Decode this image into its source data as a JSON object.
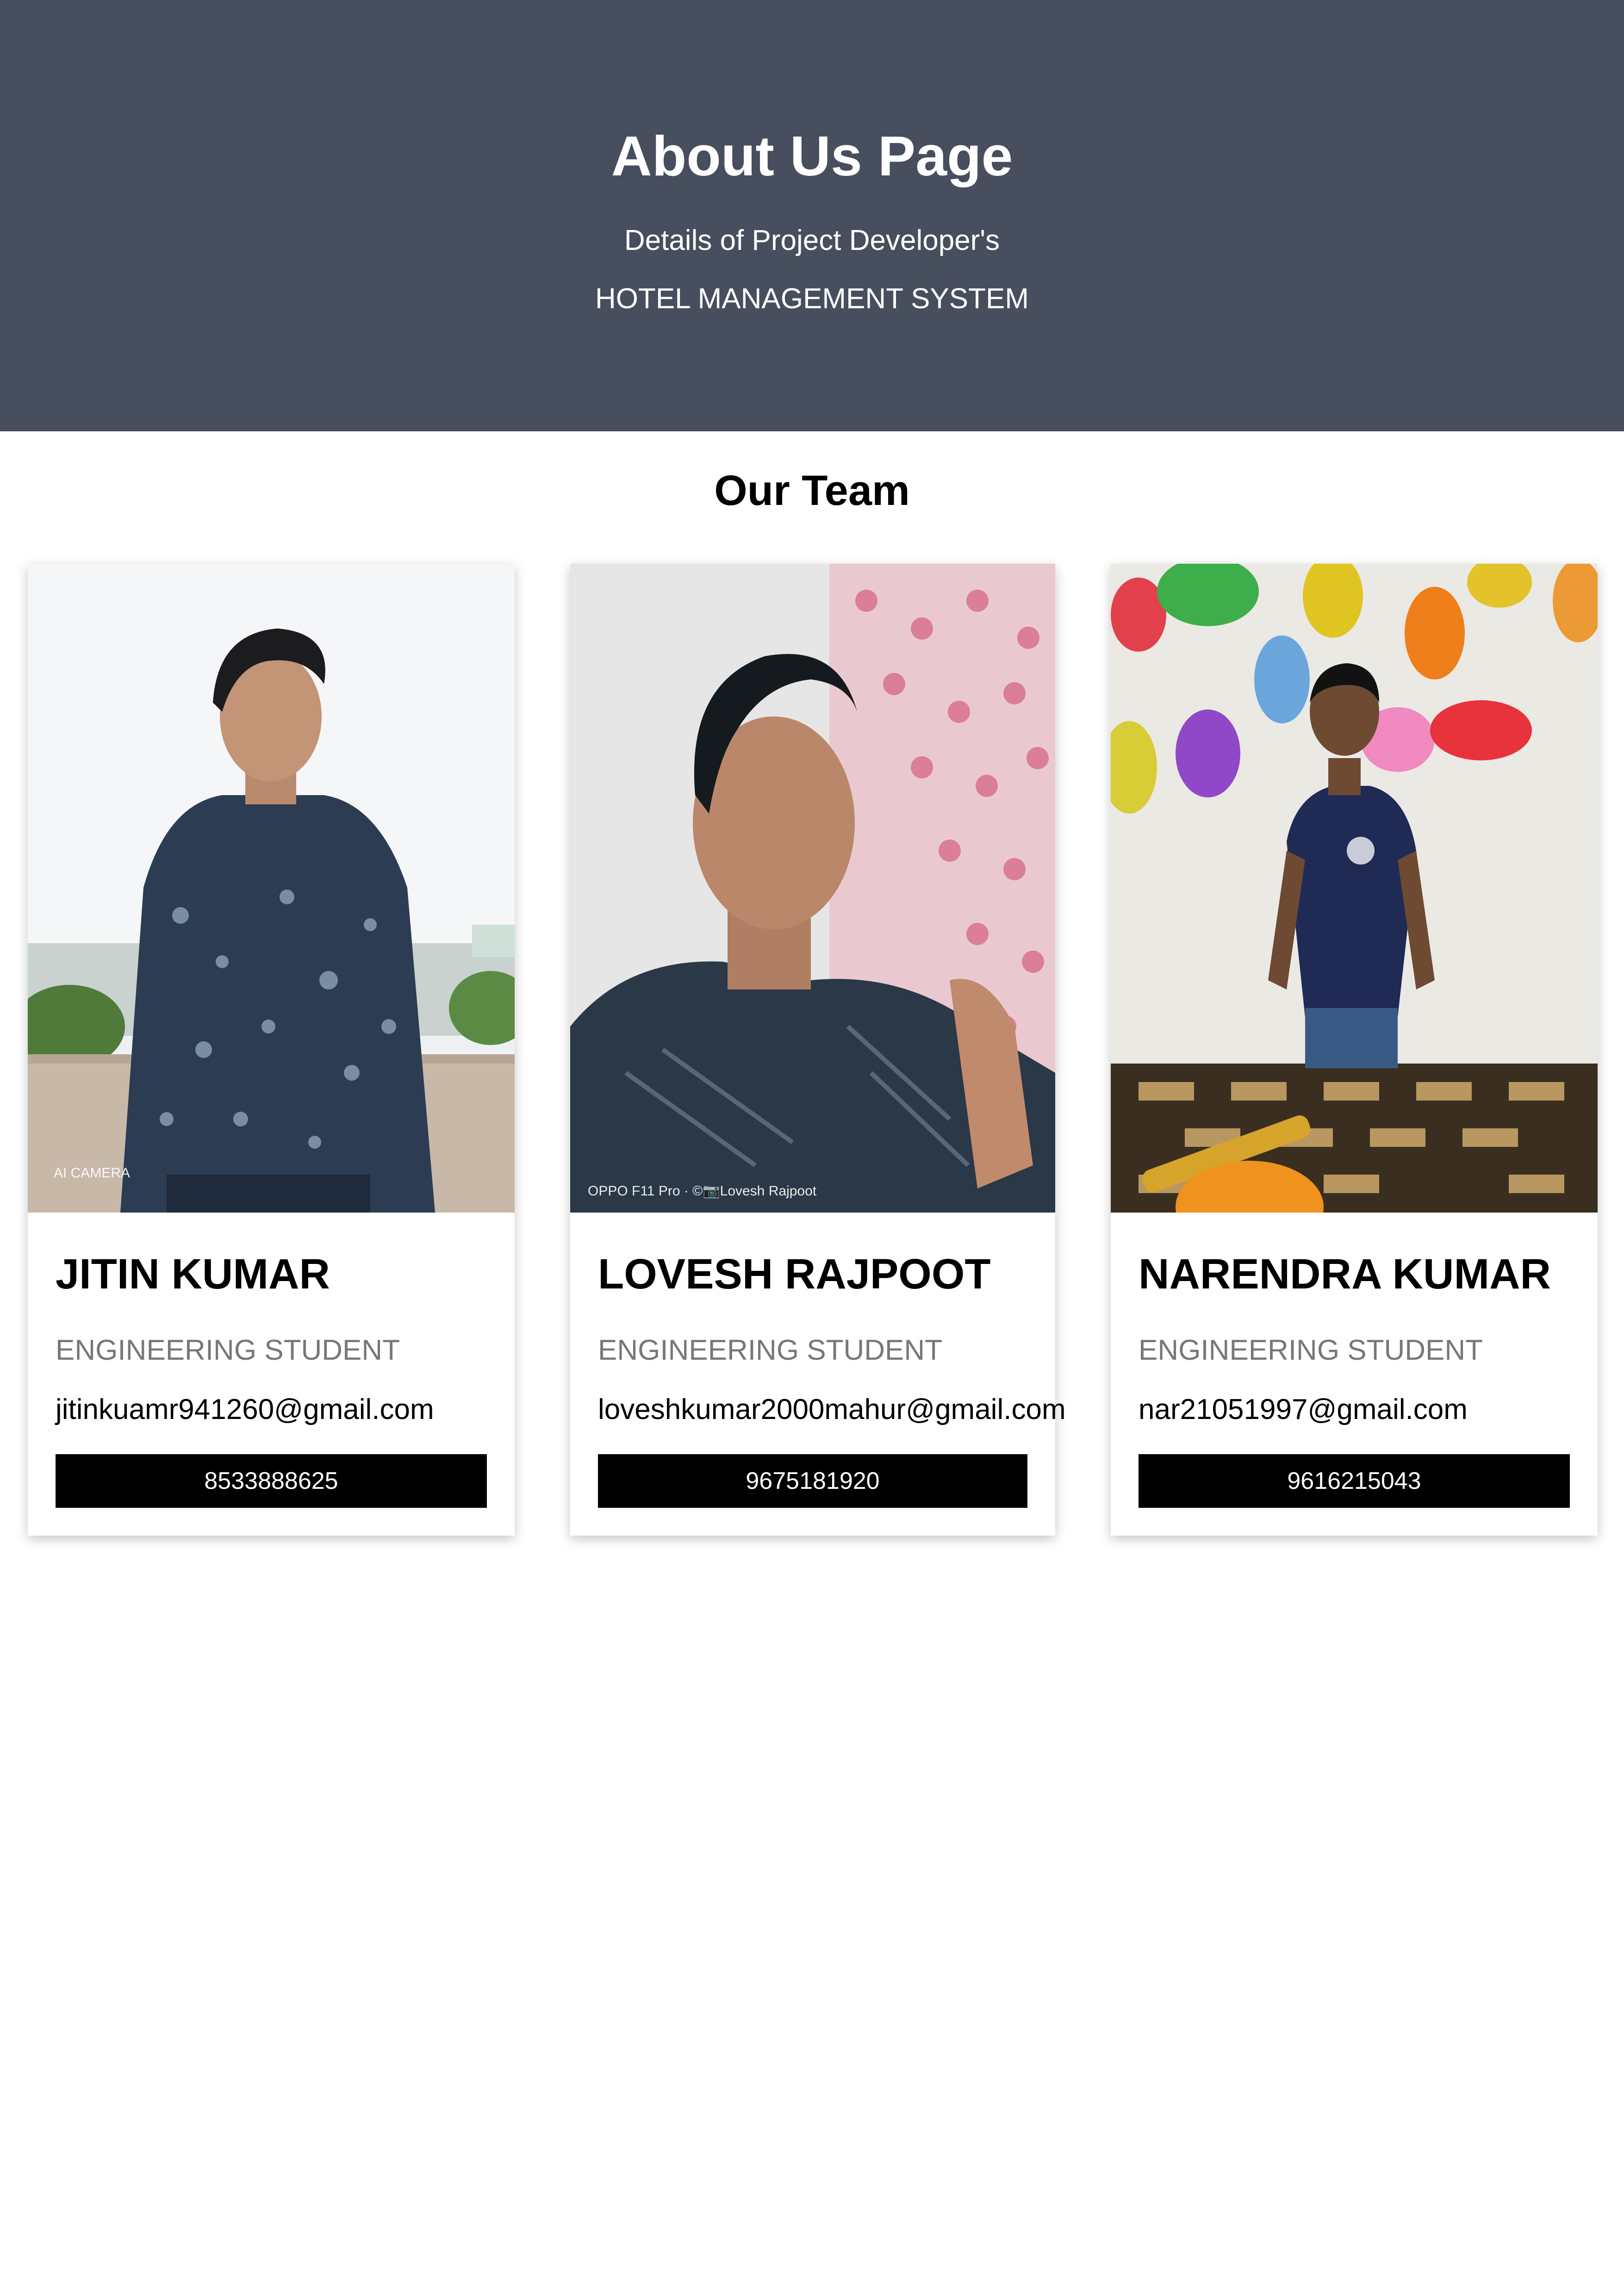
{
  "header": {
    "title": "About Us Page",
    "subtitle": "Details of Project Developer's",
    "project": "HOTEL MANAGEMENT SYSTEM",
    "background_color": "#474e5d"
  },
  "team": {
    "heading": "Our Team",
    "members": [
      {
        "name": "JITIN KUMAR",
        "title": "ENGINEERING STUDENT",
        "email": "jitinkuamr941260@gmail.com",
        "contact": "8533888625",
        "photo_watermark": "AI CAMERA"
      },
      {
        "name": "LOVESH RAJPOOT",
        "title": "ENGINEERING STUDENT",
        "email": "loveshkumar2000mahur@gmail.com",
        "contact": "9675181920",
        "photo_watermark": "OPPO F11 Pro · ©📷Lovesh Rajpoot"
      },
      {
        "name": "NARENDRA KUMAR",
        "title": "ENGINEERING STUDENT",
        "email": "nar21051997@gmail.com",
        "contact": "9616215043",
        "photo_watermark": ""
      }
    ]
  }
}
